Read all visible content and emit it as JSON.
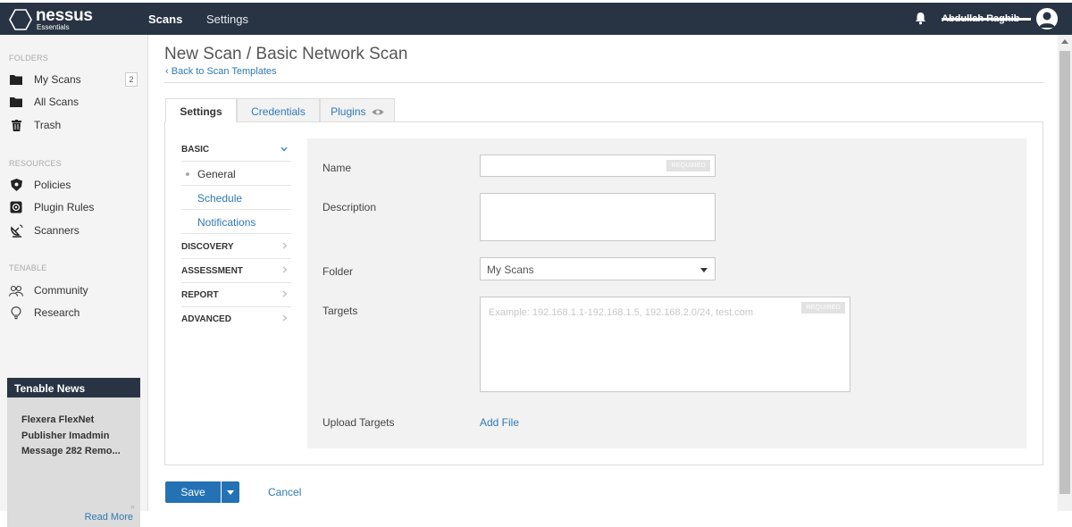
{
  "header": {
    "brand": "nessus",
    "edition": "Essentials",
    "nav": [
      "Scans",
      "Settings"
    ],
    "username": "Abdullah Raghib"
  },
  "sidebar": {
    "sections": {
      "folders": "FOLDERS",
      "resources": "RESOURCES",
      "tenable": "TENABLE"
    },
    "folders": [
      {
        "label": "My Scans",
        "icon": "folder-icon",
        "count": "2"
      },
      {
        "label": "All Scans",
        "icon": "folder-icon"
      },
      {
        "label": "Trash",
        "icon": "trash-icon"
      }
    ],
    "resources": [
      {
        "label": "Policies",
        "icon": "shield-icon"
      },
      {
        "label": "Plugin Rules",
        "icon": "plugin-rules-icon"
      },
      {
        "label": "Scanners",
        "icon": "satellite-dish-icon"
      }
    ],
    "tenable": [
      {
        "label": "Community",
        "icon": "community-icon"
      },
      {
        "label": "Research",
        "icon": "lightbulb-icon"
      }
    ],
    "news": {
      "title": "Tenable News",
      "body": "Flexera FlexNet Publisher Imadmin Message 282 Remo...",
      "read_more": "Read More"
    }
  },
  "page": {
    "title": "New Scan / Basic Network Scan",
    "back_link": "Back to Scan Templates"
  },
  "tabs": [
    {
      "label": "Settings",
      "active": true
    },
    {
      "label": "Credentials"
    },
    {
      "label": "Plugins"
    }
  ],
  "settings_nav": {
    "basic": "BASIC",
    "basic_items": [
      "General",
      "Schedule",
      "Notifications"
    ],
    "categories": [
      "DISCOVERY",
      "ASSESSMENT",
      "REPORT",
      "ADVANCED"
    ]
  },
  "form": {
    "name_label": "Name",
    "name_value": "",
    "required_tag": "REQUIRED",
    "description_label": "Description",
    "description_value": "",
    "folder_label": "Folder",
    "folder_value": "My Scans",
    "targets_label": "Targets",
    "targets_placeholder": "Example: 192.168.1.1-192.168.1.5, 192.168.2.0/24, test.com",
    "upload_label": "Upload Targets",
    "add_file": "Add File"
  },
  "actions": {
    "save": "Save",
    "cancel": "Cancel"
  },
  "colors": {
    "header_bg": "#283443",
    "accent": "#2472b4",
    "link": "#2e79b6"
  }
}
